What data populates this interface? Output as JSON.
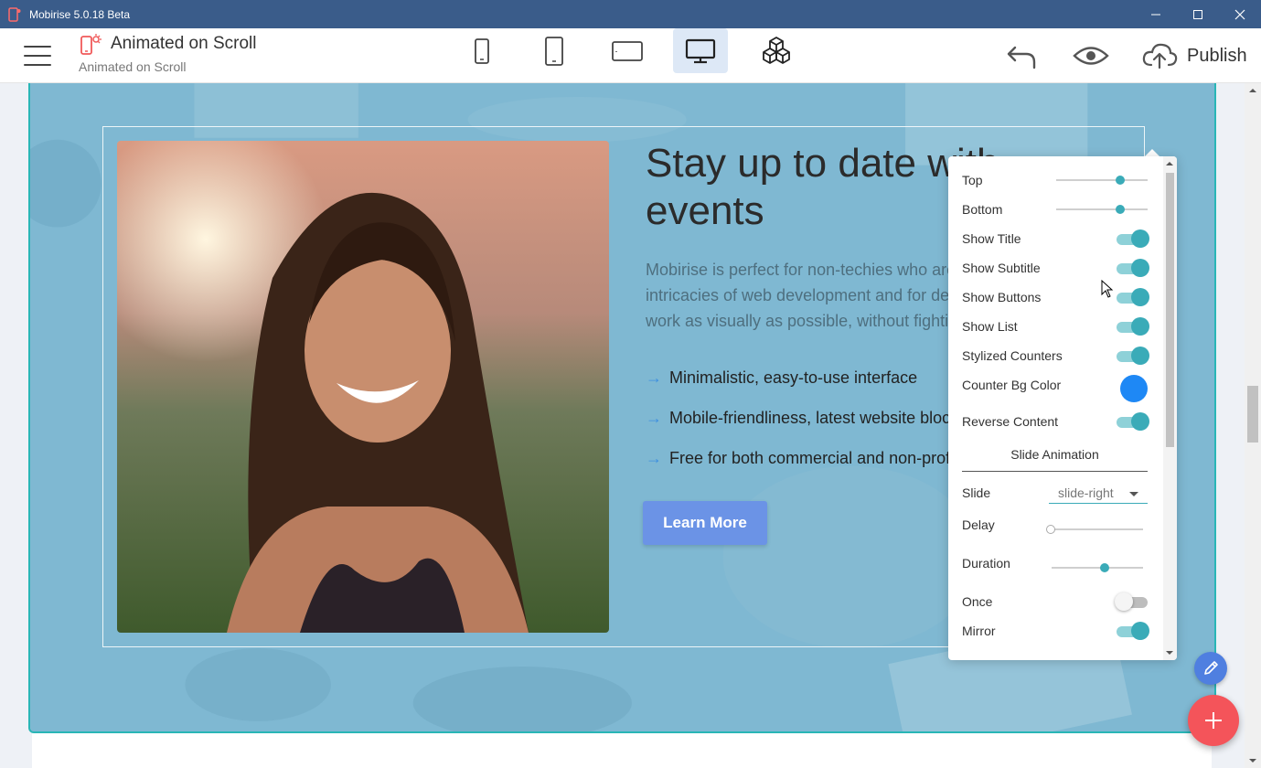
{
  "window": {
    "title": "Mobirise 5.0.18 Beta",
    "controls": {
      "minimize": "minimize-icon",
      "maximize": "maximize-icon",
      "close": "close-icon"
    }
  },
  "toolbar": {
    "menu_icon": "hamburger-icon",
    "site_title": "Animated on Scroll",
    "site_subtitle": "Animated on Scroll",
    "devices": [
      {
        "name": "mobile-portrait",
        "icon": "phone-small-icon",
        "active": false
      },
      {
        "name": "mobile-large",
        "icon": "phone-large-icon",
        "active": false
      },
      {
        "name": "tablet",
        "icon": "tablet-icon",
        "active": false
      },
      {
        "name": "desktop",
        "icon": "desktop-icon",
        "active": true
      },
      {
        "name": "blocks",
        "icon": "cubes-icon",
        "active": false
      }
    ],
    "undo_icon": "undo-icon",
    "preview_icon": "eye-icon",
    "publish_label": "Publish"
  },
  "block": {
    "headline": "Stay up to date with events",
    "subtext": "Mobirise is perfect for non-techies who are not familiar with the intricacies of web development and for designers who prefer to work as visually as possible, without fighting with code.",
    "list": [
      "Minimalistic, easy-to-use interface",
      "Mobile-friendliness, latest website blocks",
      "Free for both commercial and non-profit use"
    ],
    "button_label": "Learn More"
  },
  "panel": {
    "rows": [
      {
        "label": "Top",
        "type": "slider",
        "value": 0.7
      },
      {
        "label": "Bottom",
        "type": "slider",
        "value": 0.7
      },
      {
        "label": "Show Title",
        "type": "toggle",
        "on": true
      },
      {
        "label": "Show Subtitle",
        "type": "toggle",
        "on": true
      },
      {
        "label": "Show Buttons",
        "type": "toggle",
        "on": true
      },
      {
        "label": "Show List",
        "type": "toggle",
        "on": true
      },
      {
        "label": "Stylized Counters",
        "type": "toggle",
        "on": true
      },
      {
        "label": "Counter Bg Color",
        "type": "color",
        "color": "#1e88f5"
      },
      {
        "label": "Reverse Content",
        "type": "toggle",
        "on": true
      }
    ],
    "section_title": "Slide Animation",
    "slide": {
      "label": "Slide",
      "value": "slide-right"
    },
    "delay": {
      "label": "Delay",
      "value": 0.0
    },
    "duration": {
      "label": "Duration",
      "value": 0.58
    },
    "once": {
      "label": "Once",
      "on": false
    },
    "mirror": {
      "label": "Mirror",
      "on": true
    }
  },
  "colors": {
    "accent": "#3aabb8",
    "title_bar": "#3a5c8a",
    "fab_add": "#f4545a",
    "fab_edit": "#4f7fe0",
    "button": "#6b93e6"
  }
}
